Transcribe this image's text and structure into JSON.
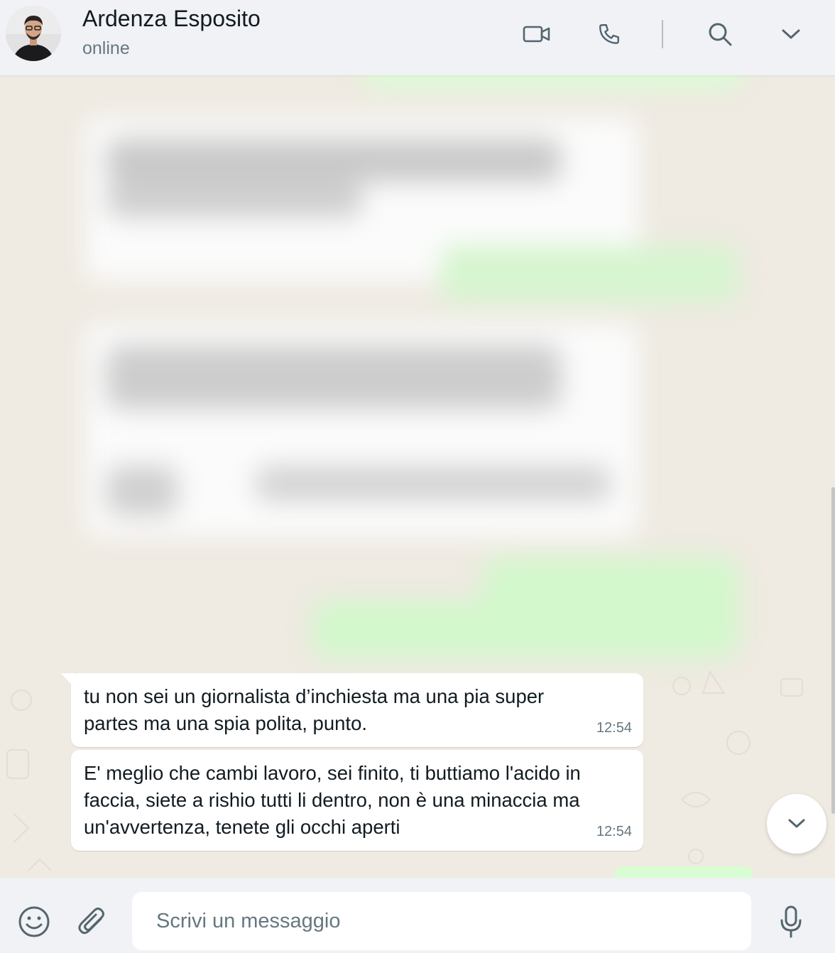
{
  "header": {
    "contact_name": "Ardenza Esposito",
    "status": "online",
    "icons": [
      "video-call-icon",
      "voice-call-icon",
      "search-icon",
      "chevron-down-icon"
    ]
  },
  "messages": [
    {
      "direction": "incoming",
      "text": "tu non sei un giornalista d’inchiesta ma una pia super partes ma una spia polita, punto.",
      "time": "12:54"
    },
    {
      "direction": "incoming",
      "text": "E' meglio che cambi lavoro, sei finito, ti buttiamo l'acido in faccia, siete a rishio tutti li dentro, non è una minaccia ma un'avvertenza, tenete gli occhi aperti",
      "time": "12:54"
    }
  ],
  "composer": {
    "placeholder": "Scrivi un messaggio"
  },
  "colors": {
    "header_bg": "#f0f2f5",
    "chat_bg": "#efeae2",
    "incoming_bubble": "#ffffff",
    "outgoing_bubble": "#d9fdd3",
    "icon": "#54656f"
  }
}
